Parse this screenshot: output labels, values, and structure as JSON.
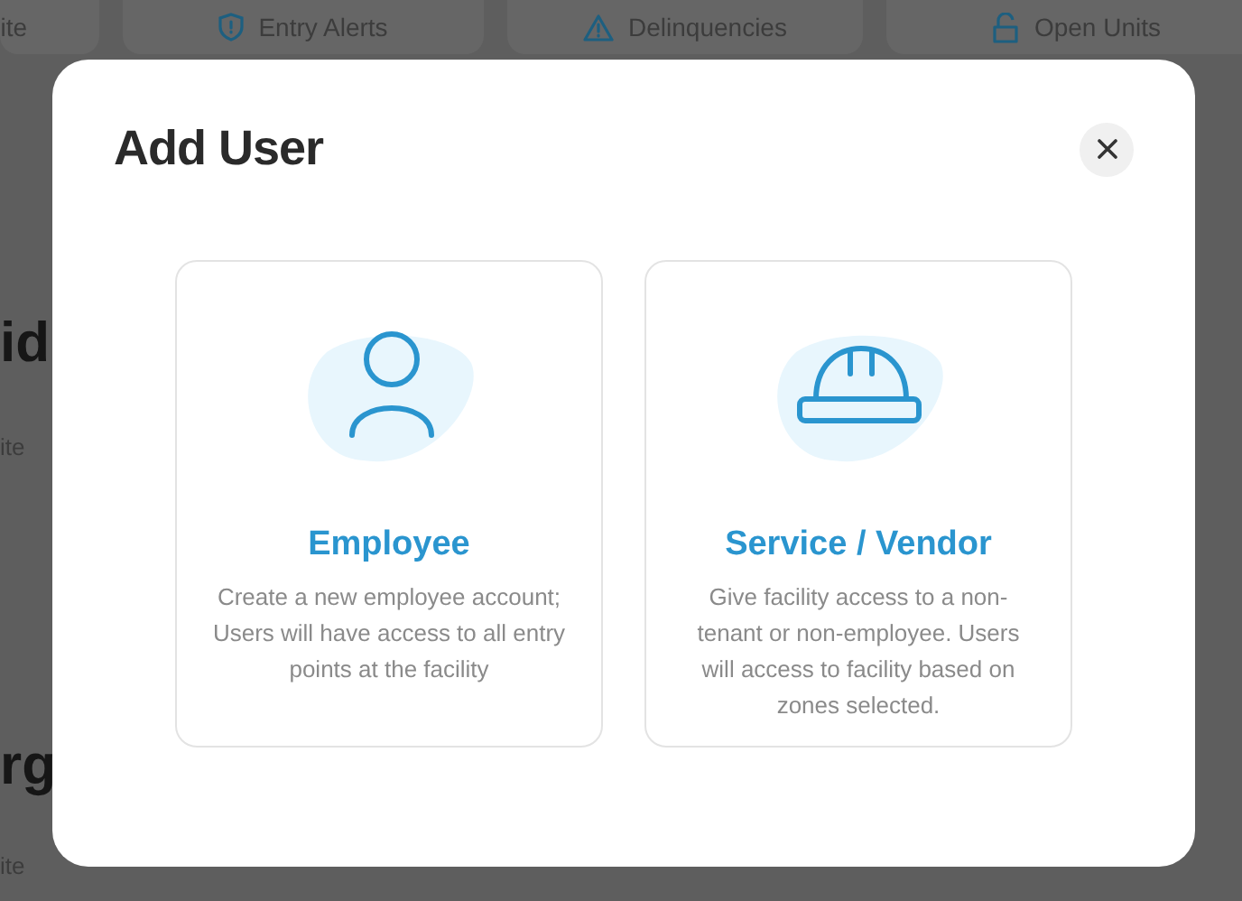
{
  "background": {
    "top_cards": [
      {
        "label": "ite",
        "kind": "plain"
      },
      {
        "label": "Entry Alerts",
        "kind": "alerts"
      },
      {
        "label": "Delinquencies",
        "kind": "delinquencies"
      },
      {
        "label": "Open Units",
        "kind": "units"
      }
    ],
    "side_texts": [
      {
        "text": "id",
        "kind": "heading"
      },
      {
        "text": "ite",
        "kind": "caption"
      },
      {
        "text": "rg",
        "kind": "heading"
      },
      {
        "text": "ite",
        "kind": "caption"
      }
    ]
  },
  "modal": {
    "title": "Add User",
    "options": [
      {
        "kind": "employee",
        "title": "Employee",
        "description": "Create a new employee account; Users will have access to all entry points at the facility"
      },
      {
        "kind": "vendor",
        "title": "Service / Vendor",
        "description": "Give facility access to a non-tenant or non-employee. Users will access to facility based on zones selected."
      }
    ]
  }
}
